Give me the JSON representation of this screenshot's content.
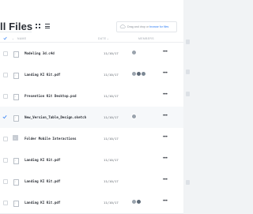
{
  "page": {
    "title": "ll Files"
  },
  "toolbar": {
    "grid_view_icon": "grid-icon",
    "list_view_icon": "list-icon",
    "drop_zone": {
      "text": "Drag and drop or ",
      "link": "browse for files",
      "icon": "cloud-upload-icon"
    }
  },
  "table": {
    "headers": {
      "name": "NAME",
      "date": "DATE",
      "members": "MEMBERS"
    },
    "rows": [
      {
        "name": "Modeling 3d.c4d",
        "date": "11/10/17",
        "icon": "file-icon",
        "avatars": 1,
        "selected": false
      },
      {
        "name": "Landing KI Kit.pdf",
        "date": "11/10/17",
        "icon": "file-icon",
        "avatars": 3,
        "selected": false
      },
      {
        "name": "Presention Kit Desktop.psd",
        "date": "11/10/17",
        "icon": "file-icon",
        "avatars": 0,
        "selected": false
      },
      {
        "name": "New_Version_Table_Design.sketch",
        "date": "11/10/17",
        "icon": "file-icon",
        "avatars": 1,
        "selected": true
      },
      {
        "name": "Folder Mobile Interactions",
        "date": "11/10/17",
        "icon": "folder-icon",
        "avatars": 0,
        "selected": false
      },
      {
        "name": "Landing KI Kit.pdf",
        "date": "11/10/17",
        "icon": "file-icon",
        "avatars": 0,
        "selected": false
      },
      {
        "name": "Landing KI Kit.pdf",
        "date": "11/10/17",
        "icon": "file-icon",
        "avatars": 0,
        "selected": false
      },
      {
        "name": "Landing KI Kit.pdf",
        "date": "11/10/17",
        "icon": "file-icon",
        "avatars": 2,
        "selected": false
      }
    ]
  },
  "colors": {
    "accent": "#2f7ef5",
    "avatar_1": "#9aa3ad",
    "avatar_2": "#5f6b78",
    "avatar_3": "#7c8894"
  }
}
